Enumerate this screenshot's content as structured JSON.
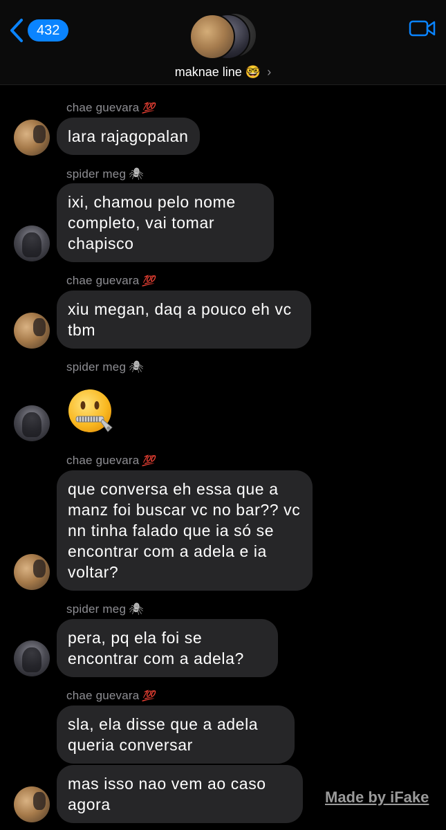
{
  "header": {
    "back_count": "432",
    "group_name": "maknae line",
    "group_emoji": "🤓",
    "chevron": "›"
  },
  "messages": [
    {
      "sender": "chae guevara",
      "sender_emoji": "💯",
      "text": "lara rajagopalan"
    },
    {
      "sender": "spider meg",
      "sender_emoji": "🕷",
      "text": "ixi, chamou pelo nome completo, vai tomar chapisco"
    },
    {
      "sender": "chae guevara",
      "sender_emoji": "💯",
      "text": "xiu megan, daq a pouco eh vc tbm"
    },
    {
      "sender": "spider meg",
      "sender_emoji": "🕷",
      "text": "🤐"
    },
    {
      "sender": "chae guevara",
      "sender_emoji": "💯",
      "text": "que conversa eh essa que a manz foi buscar vc no bar?? vc nn tinha falado que ia só se encontrar com a adela e ia voltar?"
    },
    {
      "sender": "spider meg",
      "sender_emoji": "🕷",
      "text": "pera, pq ela foi se encontrar com a adela?"
    },
    {
      "sender": "chae guevara",
      "sender_emoji": "💯",
      "text": "sla, ela disse que a adela queria conversar"
    },
    {
      "sender": "",
      "sender_emoji": "",
      "text": "mas isso nao vem ao caso agora"
    }
  ],
  "watermark": "Made by iFake"
}
